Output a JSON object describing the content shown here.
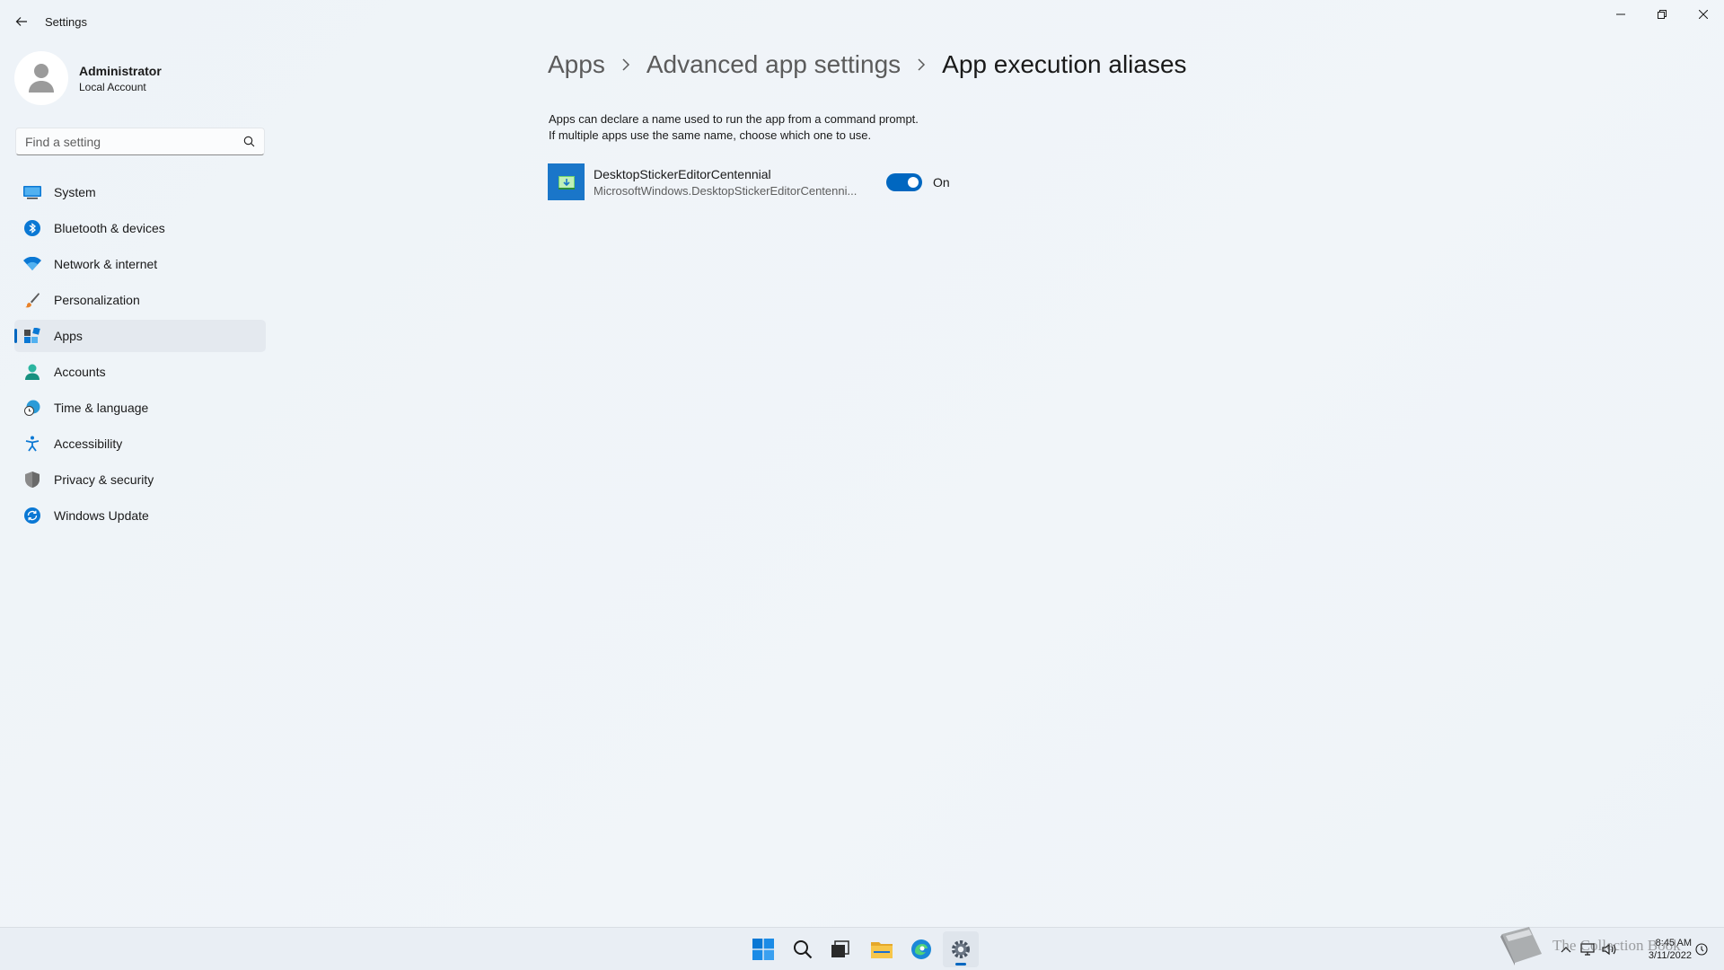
{
  "window": {
    "title": "Settings"
  },
  "user": {
    "name": "Administrator",
    "account_type": "Local Account"
  },
  "search": {
    "placeholder": "Find a setting"
  },
  "nav": {
    "items": [
      {
        "label": "System",
        "icon": "monitor-icon",
        "active": false
      },
      {
        "label": "Bluetooth & devices",
        "icon": "bluetooth-icon",
        "active": false
      },
      {
        "label": "Network & internet",
        "icon": "wifi-icon",
        "active": false
      },
      {
        "label": "Personalization",
        "icon": "brush-icon",
        "active": false
      },
      {
        "label": "Apps",
        "icon": "apps-icon",
        "active": true
      },
      {
        "label": "Accounts",
        "icon": "person-icon",
        "active": false
      },
      {
        "label": "Time & language",
        "icon": "globe-clock-icon",
        "active": false
      },
      {
        "label": "Accessibility",
        "icon": "accessibility-icon",
        "active": false
      },
      {
        "label": "Privacy & security",
        "icon": "shield-icon",
        "active": false
      },
      {
        "label": "Windows Update",
        "icon": "update-icon",
        "active": false
      }
    ]
  },
  "breadcrumb": {
    "items": [
      "Apps",
      "Advanced app settings"
    ],
    "current": "App execution aliases"
  },
  "description": {
    "line1": "Apps can declare a name used to run the app from a command prompt.",
    "line2": "If multiple apps use the same name, choose which one to use."
  },
  "aliases": [
    {
      "name": "DesktopStickerEditorCentennial",
      "package": "MicrosoftWindows.DesktopStickerEditorCentenni...",
      "state_label": "On",
      "enabled": true
    }
  ],
  "taskbar": {
    "apps": [
      "start-icon",
      "search-icon",
      "task-view-icon",
      "file-explorer-icon",
      "edge-icon",
      "settings-icon"
    ],
    "time": "8:45 AM",
    "date": "3/11/2022"
  },
  "watermark": {
    "text": "The Collection Book"
  },
  "colors": {
    "accent": "#0067c0",
    "background": "#eff4f9",
    "nav_active": "#e4e9ef"
  }
}
